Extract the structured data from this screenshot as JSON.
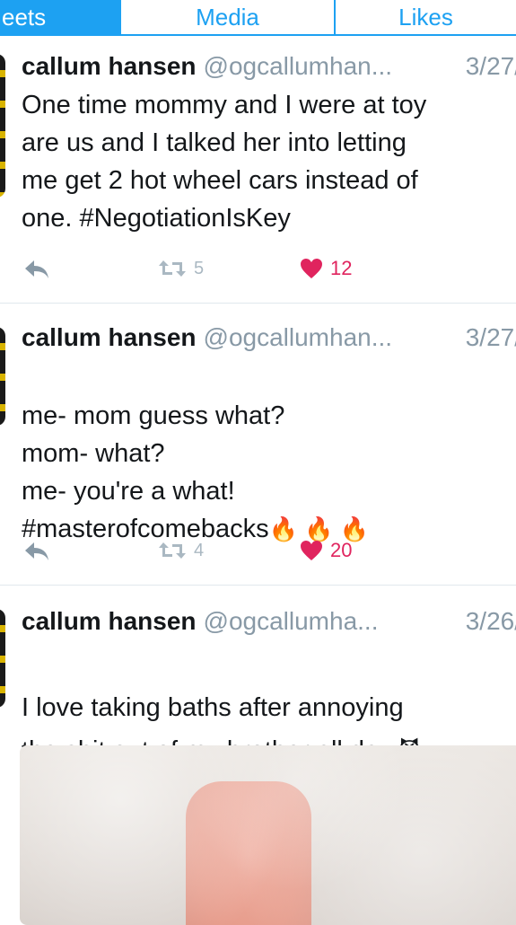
{
  "tabs": [
    {
      "label": "eets",
      "active": true
    },
    {
      "label": "Media",
      "active": false
    },
    {
      "label": "Likes",
      "active": false
    }
  ],
  "tweets": [
    {
      "name": "callum hansen",
      "handle": "@ogcallumhan...",
      "date": "3/27/",
      "text": "One time mommy and I were at toy\nare us and I talked her into letting\nme get 2 hot wheel cars instead of\none. #NegotiationIsKey",
      "retweets": "5",
      "likes": "12"
    },
    {
      "name": "callum hansen",
      "handle": "@ogcallumhan...",
      "date": "3/27/",
      "text": "me- mom guess what?\nmom- what?\nme- you're a what!\n#masterofcomebacks",
      "emoji": "🔥 🔥 🔥",
      "retweets": "4",
      "likes": "20"
    },
    {
      "name": "callum hansen",
      "handle": "@ogcallumha...",
      "date": "3/26/",
      "text": "I love taking baths after annoying\nthe shit out of my brother all day.",
      "emoji": "😈"
    }
  ],
  "colors": {
    "accent": "#1da1f2",
    "like": "#e0245e",
    "muted": "#8899a6"
  }
}
